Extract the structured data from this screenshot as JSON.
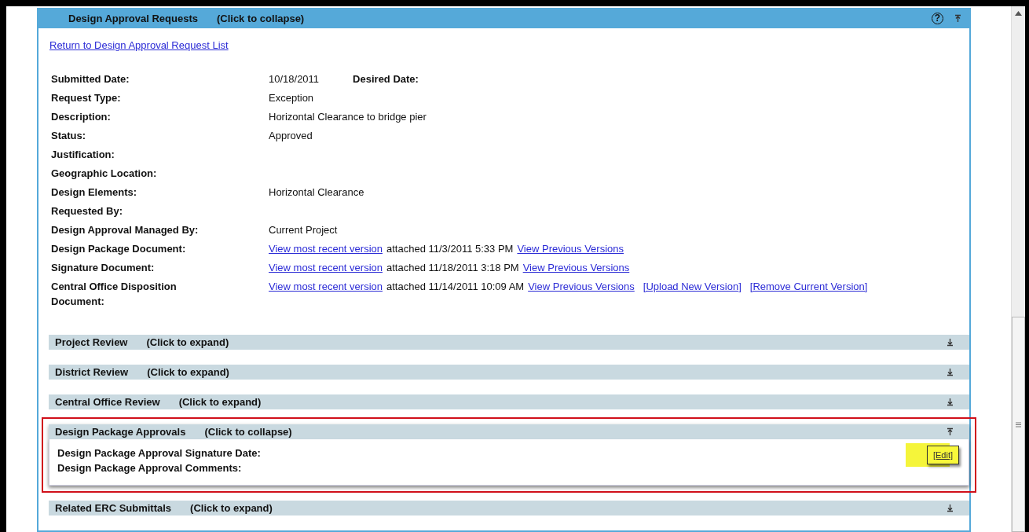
{
  "panel": {
    "title": "Design Approval Requests",
    "hint": "(Click to collapse)",
    "expanded": true,
    "help": "?"
  },
  "return_link": "Return to Design Approval Request List",
  "fields": [
    {
      "label": "Submitted Date:",
      "value": [
        {
          "kind": "text",
          "text": "10/18/2011"
        },
        {
          "kind": "label",
          "text": "Desired Date:"
        }
      ]
    },
    {
      "label": "Request Type:",
      "value": [
        {
          "kind": "text",
          "text": "Exception"
        }
      ]
    },
    {
      "label": "Description:",
      "value": [
        {
          "kind": "text",
          "text": "Horizontal Clearance to bridge pier"
        }
      ]
    },
    {
      "label": "Status:",
      "value": [
        {
          "kind": "text",
          "text": "Approved"
        }
      ]
    },
    {
      "label": "Justification:"
    },
    {
      "label": "Geographic Location:"
    },
    {
      "label": "Design Elements:",
      "value": [
        {
          "kind": "text",
          "text": "Horizontal Clearance"
        }
      ]
    },
    {
      "label": "Requested By:"
    },
    {
      "label": "Design Approval Managed By:",
      "value": [
        {
          "kind": "text",
          "text": "Current Project"
        }
      ]
    },
    {
      "label": "Design Package Document:",
      "value": [
        {
          "kind": "link",
          "text": "View most recent version"
        },
        {
          "kind": "text",
          "text": "attached 11/3/2011 5:33 PM"
        },
        {
          "kind": "link",
          "text": "View Previous Versions"
        }
      ]
    },
    {
      "label": "Signature Document:",
      "value": [
        {
          "kind": "link",
          "text": "View most recent version"
        },
        {
          "kind": "text",
          "text": "attached 11/18/2011 3:18 PM"
        },
        {
          "kind": "link",
          "text": "View Previous Versions"
        }
      ]
    },
    {
      "label": "Central Office Disposition Document:",
      "value": [
        {
          "kind": "link",
          "text": "View most recent version"
        },
        {
          "kind": "text",
          "text": "attached 11/14/2011 10:09 AM"
        },
        {
          "kind": "link",
          "text": "View Previous Versions"
        },
        {
          "kind": "link",
          "text": "[Upload New Version]"
        },
        {
          "kind": "link",
          "text": "[Remove Current Version]"
        }
      ]
    }
  ],
  "sections": [
    {
      "title": "Project Review",
      "hint": "(Click to expand)",
      "expanded": false,
      "highlighted": false
    },
    {
      "title": "District Review",
      "hint": "(Click to expand)",
      "expanded": false,
      "highlighted": false
    },
    {
      "title": "Central Office Review",
      "hint": "(Click to expand)",
      "expanded": false,
      "highlighted": false
    },
    {
      "title": "Design Package Approvals",
      "hint": "(Click to collapse)",
      "expanded": true,
      "highlighted": true,
      "rows": [
        "Design Package Approval Signature Date:",
        "Design Package Approval Comments:"
      ],
      "action": {
        "label": "[Edit]",
        "highlighted": true
      }
    },
    {
      "title": "Related ERC Submittals",
      "hint": "(Click to expand)",
      "expanded": false,
      "highlighted": false
    }
  ]
}
